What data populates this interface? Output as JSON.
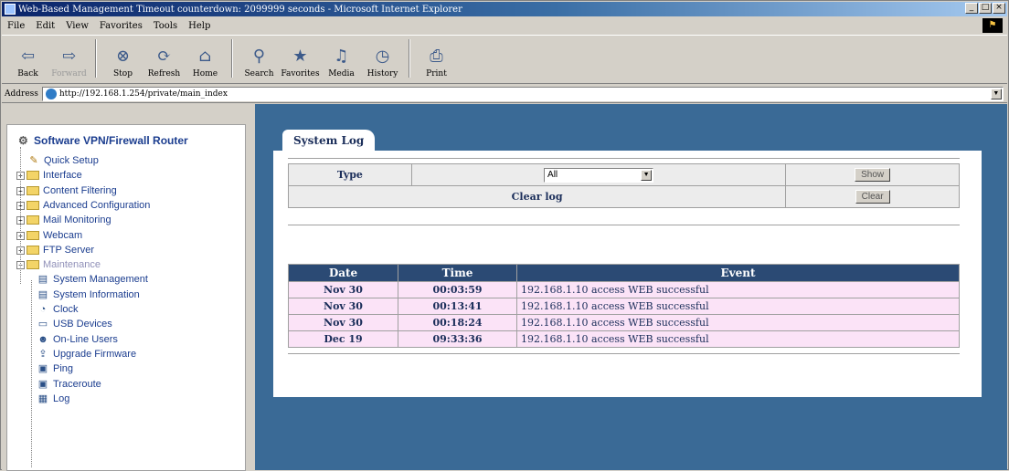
{
  "window": {
    "title": "Web-Based Management Timeout counterdown: 2099999 seconds - Microsoft Internet Explorer",
    "buttons": [
      "_",
      "□",
      "×"
    ]
  },
  "menu": [
    "File",
    "Edit",
    "View",
    "Favorites",
    "Tools",
    "Help"
  ],
  "toolbar": [
    {
      "label": "Back",
      "icon": "back-icon",
      "glyph": "⇦"
    },
    {
      "label": "Forward",
      "icon": "forward-icon",
      "glyph": "⇨",
      "disabled": true
    },
    {
      "label": "Stop",
      "icon": "stop-icon",
      "glyph": "⊗"
    },
    {
      "label": "Refresh",
      "icon": "refresh-icon",
      "glyph": "⟳"
    },
    {
      "label": "Home",
      "icon": "home-icon",
      "glyph": "⌂"
    },
    {
      "label": "Search",
      "icon": "search-icon",
      "glyph": "⚲"
    },
    {
      "label": "Favorites",
      "icon": "favorites-icon",
      "glyph": "★"
    },
    {
      "label": "Media",
      "icon": "media-icon",
      "glyph": "♫"
    },
    {
      "label": "History",
      "icon": "history-icon",
      "glyph": "◷"
    },
    {
      "label": "Print",
      "icon": "print-icon",
      "glyph": "⎙"
    }
  ],
  "address": {
    "label": "Address",
    "url": "http://192.168.1.254/private/main_index"
  },
  "sidebar": {
    "root": "Software VPN/Firewall Router",
    "items": [
      {
        "label": "Quick Setup",
        "type": "leaf",
        "glyph": "✎"
      },
      {
        "label": "Interface",
        "type": "folder"
      },
      {
        "label": "Content Filtering",
        "type": "folder"
      },
      {
        "label": "Advanced Configuration",
        "type": "folder"
      },
      {
        "label": "Mail Monitoring",
        "type": "folder"
      },
      {
        "label": "Webcam",
        "type": "folder"
      },
      {
        "label": "FTP Server",
        "type": "folder"
      },
      {
        "label": "Maintenance",
        "type": "folder-open"
      },
      {
        "label": "System Management",
        "type": "child",
        "glyph": "▤"
      },
      {
        "label": "System Information",
        "type": "child",
        "glyph": "▤"
      },
      {
        "label": "Clock",
        "type": "child",
        "glyph": "◔"
      },
      {
        "label": "USB Devices",
        "type": "child",
        "glyph": "▭"
      },
      {
        "label": "On-Line Users",
        "type": "child",
        "glyph": "☻"
      },
      {
        "label": "Upgrade Firmware",
        "type": "child",
        "glyph": "⇪"
      },
      {
        "label": "Ping",
        "type": "child",
        "glyph": "▣"
      },
      {
        "label": "Traceroute",
        "type": "child",
        "glyph": "▣"
      },
      {
        "label": "Log",
        "type": "child",
        "glyph": "▦"
      }
    ]
  },
  "main": {
    "tab": "System Log",
    "controls": {
      "type_label": "Type",
      "type_value": "All",
      "show_button": "Show",
      "clear_label": "Clear log",
      "clear_button": "Clear"
    },
    "log": {
      "columns": [
        "Date",
        "Time",
        "Event"
      ],
      "rows": [
        {
          "date": "Nov  30",
          "time": "00:03:59",
          "event": "192.168.1.10 access WEB successful"
        },
        {
          "date": "Nov  30",
          "time": "00:13:41",
          "event": "192.168.1.10 access WEB successful"
        },
        {
          "date": "Nov  30",
          "time": "00:18:24",
          "event": "192.168.1.10 access WEB successful"
        },
        {
          "date": "Dec  19",
          "time": "09:33:36",
          "event": "192.168.1.10 access WEB successful"
        }
      ]
    }
  },
  "colors": {
    "titlebar": "#0a246a",
    "main_bg": "#3a6a96",
    "log_header": "#2b4a74",
    "log_row": "#fbe3f7"
  }
}
